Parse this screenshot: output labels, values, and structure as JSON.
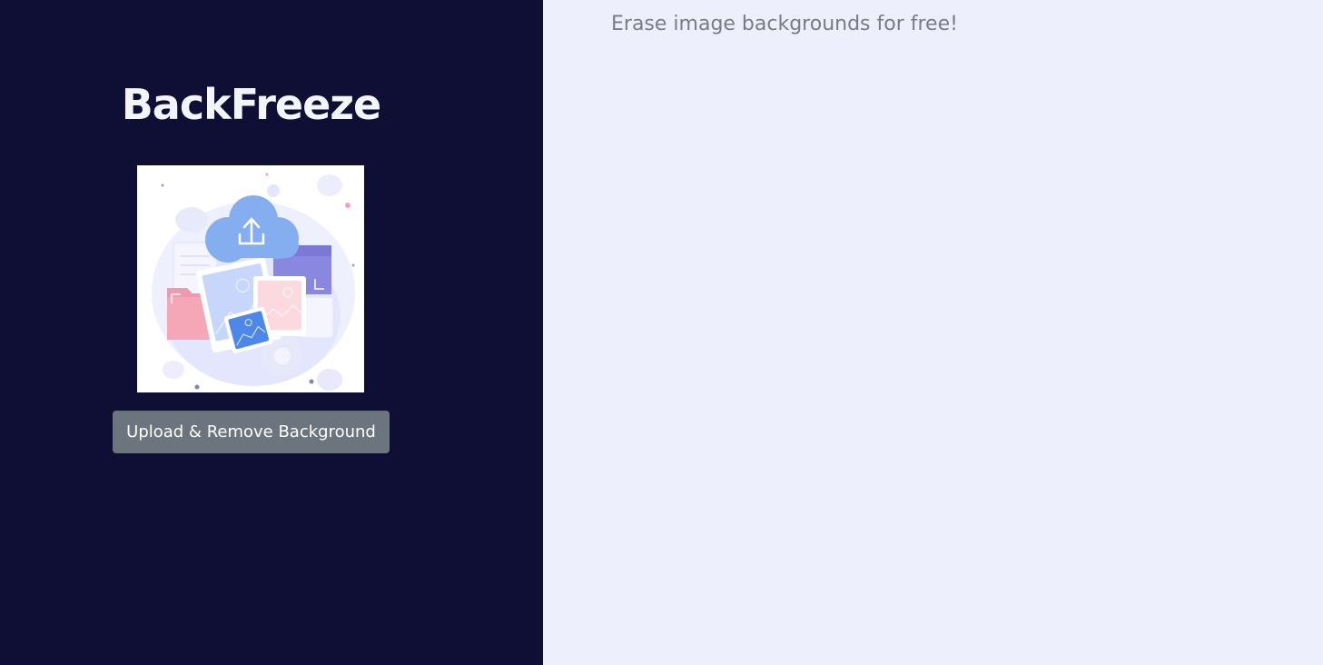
{
  "sidebar": {
    "app_title": "BackFreeze",
    "hero_image_icon": "upload-to-cloud-illustration",
    "upload_button_label": "Upload & Remove Background"
  },
  "main": {
    "tagline": "Erase image backgrounds for free!"
  },
  "colors": {
    "sidebar_background": "#0f0f35",
    "main_background": "#eeeffd",
    "button_background": "#6c757d"
  }
}
